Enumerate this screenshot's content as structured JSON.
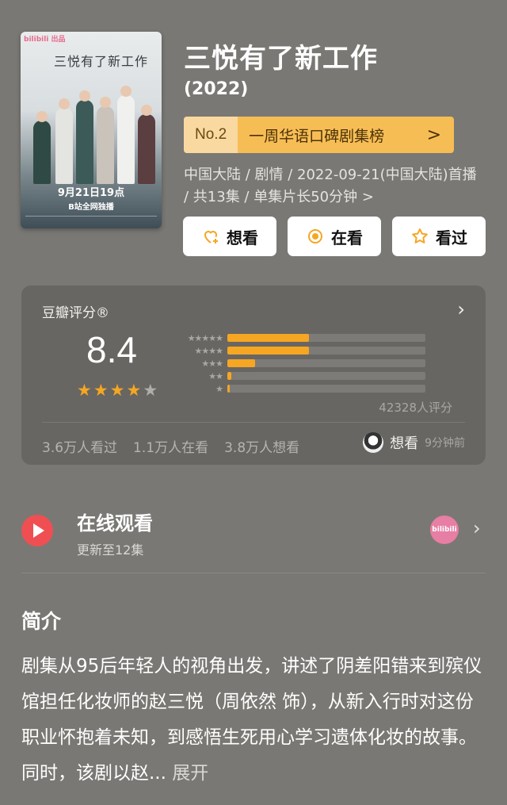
{
  "poster": {
    "badge": "bilibili 出品",
    "title": "三悦有了新工作",
    "date_line": "9月21日19点",
    "platform_line": "B站全网独播"
  },
  "header": {
    "title": "三悦有了新工作",
    "year": "(2022)",
    "rank": {
      "number": "No.2",
      "label": "一周华语口碑剧集榜",
      "chevron": ">"
    },
    "meta": "中国大陆 / 剧情 / 2022-09-21(中国大陆)首播 / 共13集 / 单集片长50分钟 >"
  },
  "actions": [
    {
      "label": "想看",
      "icon": "heart-plus-icon"
    },
    {
      "label": "在看",
      "icon": "target-circle-icon"
    },
    {
      "label": "看过",
      "icon": "star-outline-icon"
    }
  ],
  "rating": {
    "title": "豆瓣评分®",
    "score": "8.4",
    "stars": 4,
    "distribution": [
      {
        "stars": "★★★★★",
        "fraction": 0.41
      },
      {
        "stars": "★★★★",
        "fraction": 0.41
      },
      {
        "stars": "★★★",
        "fraction": 0.14
      },
      {
        "stars": "★★",
        "fraction": 0.02
      },
      {
        "stars": "★",
        "fraction": 0.01
      }
    ],
    "count": "42328人评分",
    "stats": [
      "3.6万人看过",
      "1.1万人在看",
      "3.8万人想看"
    ],
    "friend_action": "想看",
    "friend_time": "9分钟前"
  },
  "watch": {
    "title": "在线观看",
    "subtitle": "更新至12集",
    "platform": "bilibili"
  },
  "synopsis": {
    "title": "简介",
    "text": "剧集从95后年轻人的视角出发，讲述了阴差阳错来到殡仪馆担任化妆师的赵三悦（周依然 饰），从新入行时对这份职业怀抱着未知，到感悟生死用心学习遗体化妆的故事。同时，该剧以赵...",
    "expand": "展开"
  },
  "colors": {
    "background": "#7a7874",
    "card": "#686662",
    "accent": "#f5a623",
    "rank_badge": "#f7bd55"
  }
}
